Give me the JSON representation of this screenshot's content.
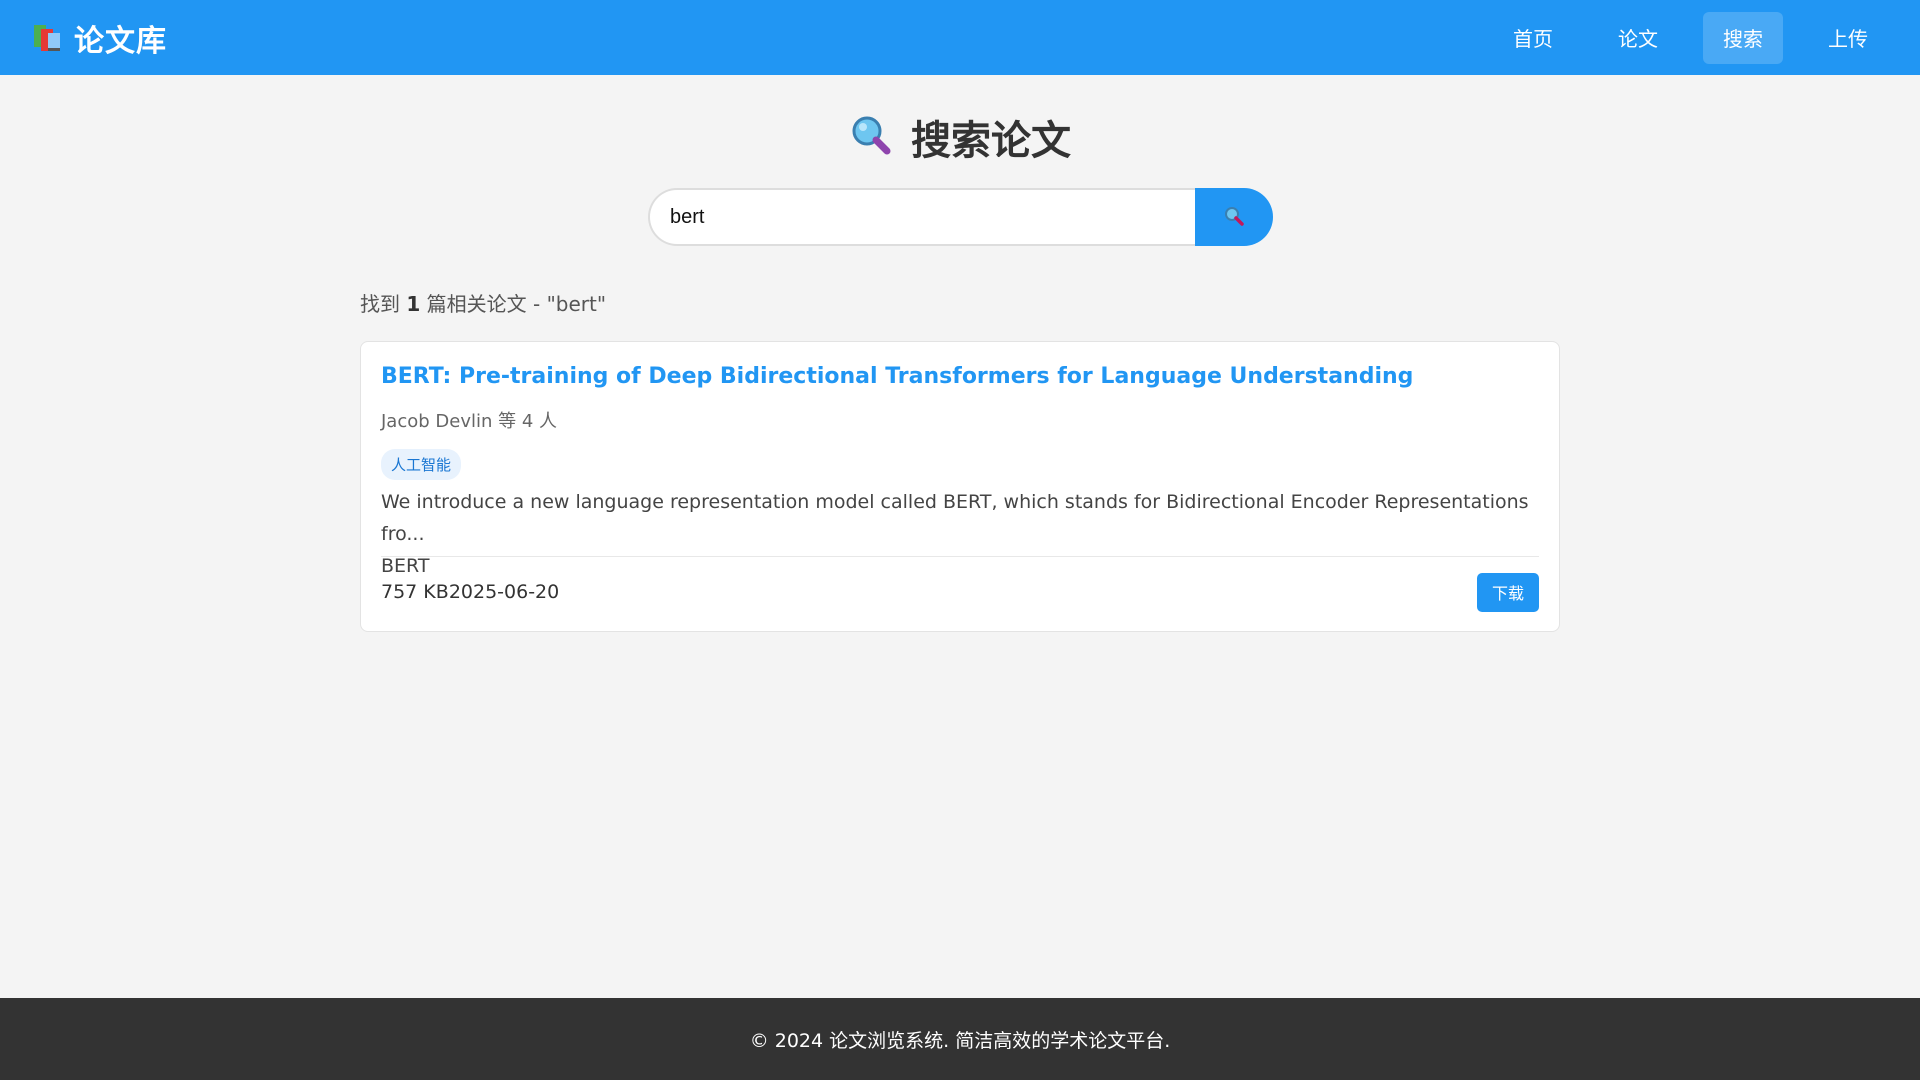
{
  "header": {
    "brand_title": "论文库",
    "brand_icon": "books-icon",
    "nav": [
      {
        "label": "首页",
        "active": false
      },
      {
        "label": "论文",
        "active": false
      },
      {
        "label": "搜索",
        "active": true
      },
      {
        "label": "上传",
        "active": false
      }
    ]
  },
  "search": {
    "heading": "搜索论文",
    "heading_icon": "magnifier-icon",
    "query": "bert",
    "button_icon": "search-icon"
  },
  "results": {
    "summary_prefix": "找到",
    "count": "1",
    "summary_suffix": "篇相关论文 - \"bert\"",
    "items": [
      {
        "title": "BERT: Pre-training of Deep Bidirectional Transformers for Language Understanding",
        "authors": "Jacob Devlin 等 4 人",
        "tag": "人工智能",
        "abstract_line1": "We introduce a new language representation model called BERT, which stands for Bidirectional Encoder Representations fro...",
        "abstract_line2": "BERT",
        "size": "757 KB",
        "date": "2025-06-20",
        "download_label": "下载"
      }
    ]
  },
  "footer": {
    "text": "© 2024 论文浏览系统. 简洁高效的学术论文平台."
  },
  "colors": {
    "primary": "#2196f3",
    "background": "#f4f4f4",
    "footer_bg": "#333333"
  }
}
